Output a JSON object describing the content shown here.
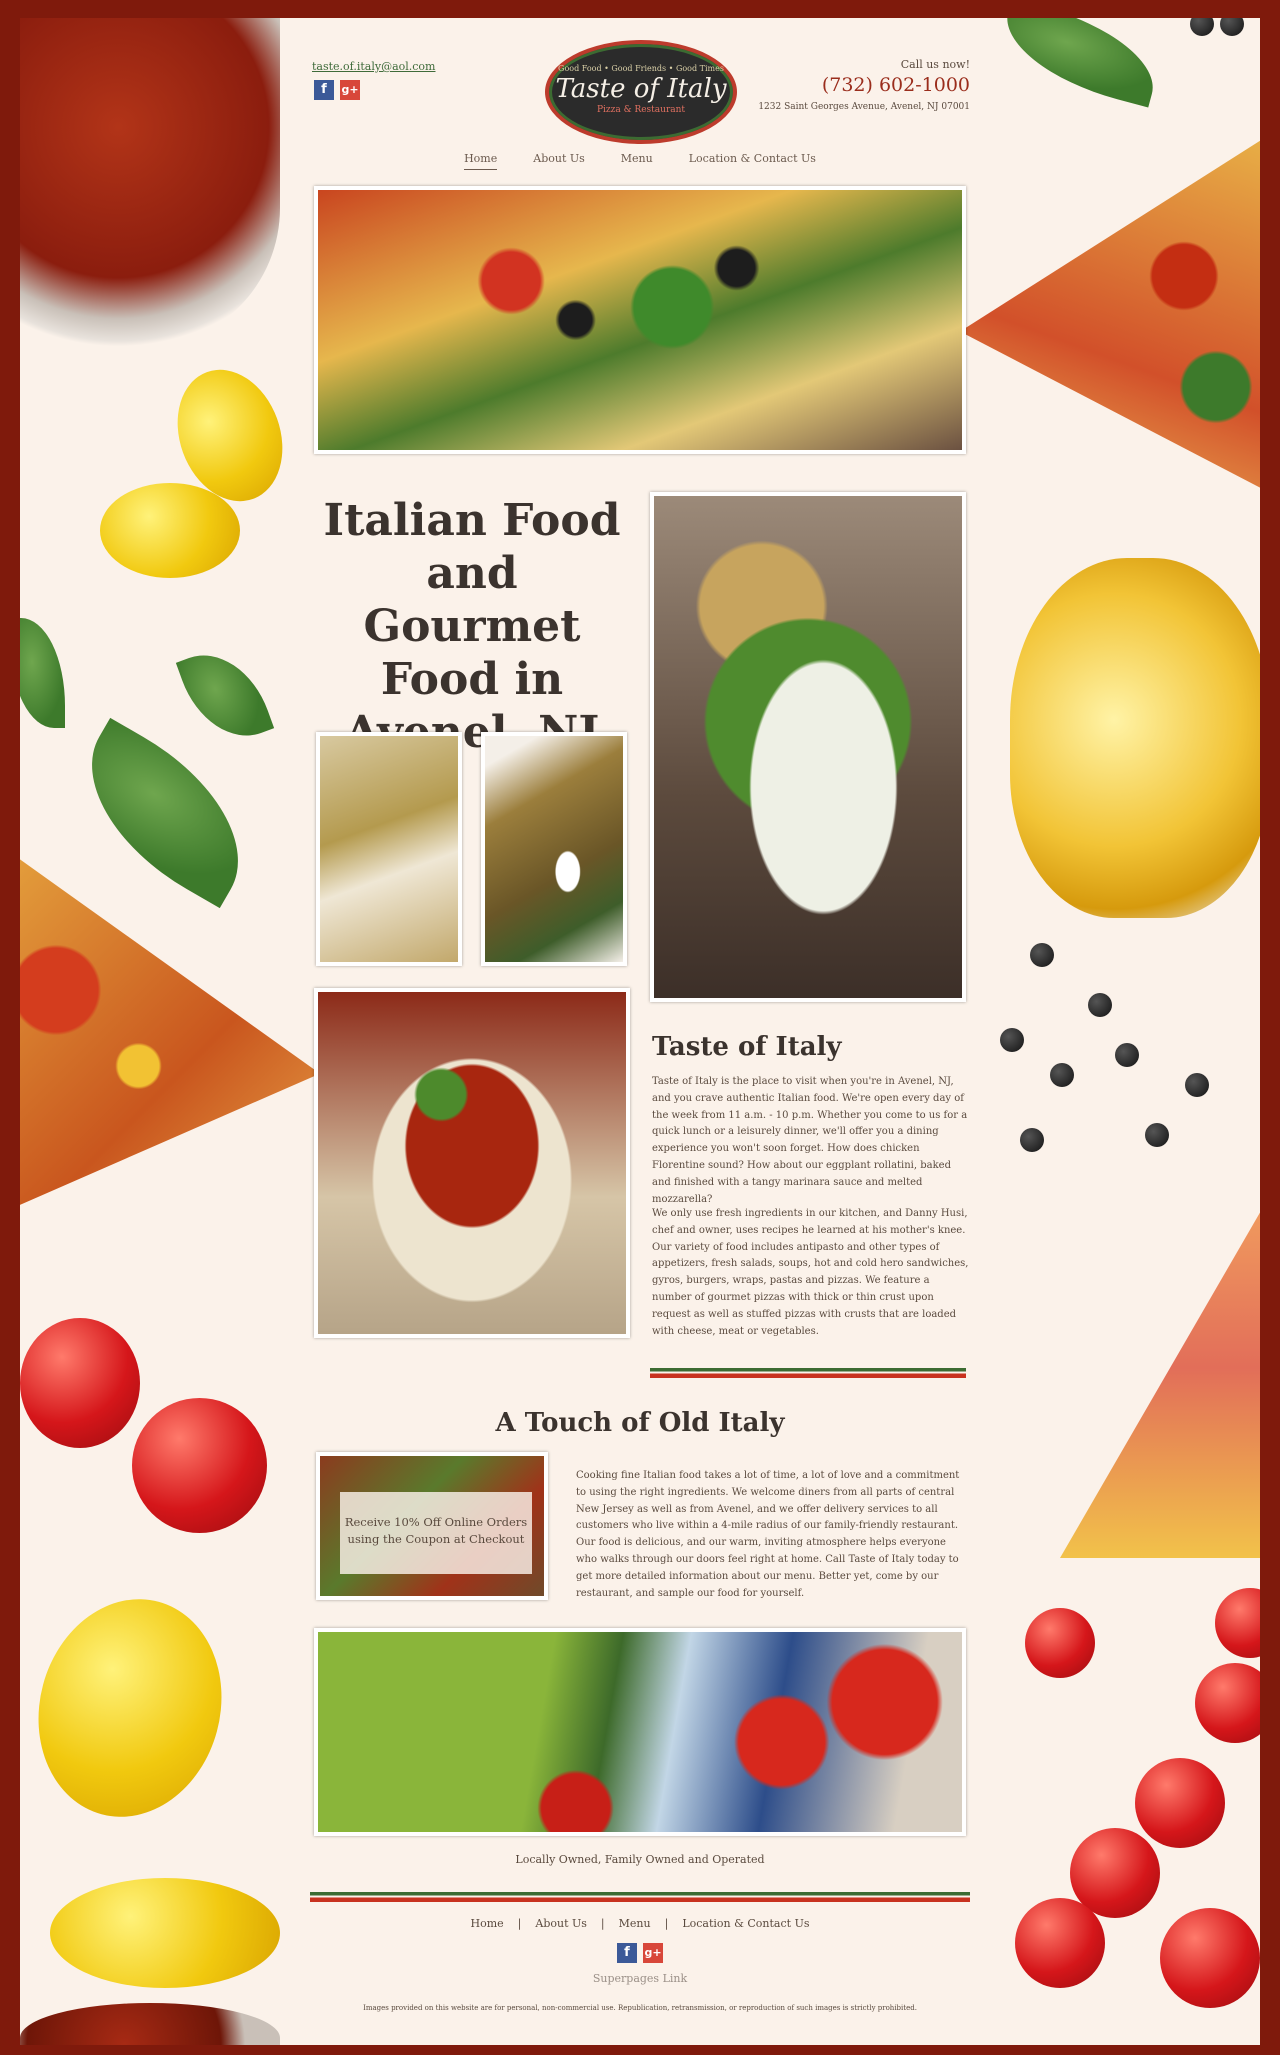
{
  "header": {
    "email": "taste.of.italy@aol.com",
    "logo": {
      "tagline": "Good Food • Good Friends • Good Times",
      "name": "Taste of Italy",
      "subtitle": "Pizza & Restaurant"
    },
    "call_label": "Call us now!",
    "phone": "(732) 602-1000",
    "address": "1232 Saint Georges Avenue, Avenel, NJ 07001",
    "social": {
      "facebook": "f",
      "google": "g+"
    }
  },
  "nav": {
    "items": [
      "Home",
      "About Us",
      "Menu",
      "Location & Contact Us"
    ],
    "active": "Home"
  },
  "main": {
    "headline": "Italian Food and Gourmet Food in Avenel, NJ",
    "about_title": "Taste of Italy",
    "about_p1": "Taste of Italy is the place to visit when you're in Avenel, NJ, and you crave authentic Italian food. We're open every day of the week from 11 a.m. - 10 p.m. Whether you come to us for a quick lunch or a leisurely dinner, we'll offer you a dining experience you won't soon forget. How does chicken Florentine sound? How about our eggplant rollatini, baked and finished with a tangy marinara sauce and melted mozzarella?",
    "about_p2": "We only use fresh ingredients in our kitchen, and Danny Husi, chef and owner, uses recipes he learned at his mother's knee. Our variety of food includes antipasto and other types of appetizers, fresh salads, soups, hot and cold hero sandwiches, gyros, burgers, wraps, pastas and pizzas. We feature a number of gourmet pizzas with thick or thin crust upon request as well as stuffed pizzas with crusts that are loaded with cheese, meat or vegetables.",
    "touch_title": "A Touch of Old Italy",
    "coupon_text": "Receive 10% Off Online Orders using the Coupon at Checkout",
    "touch_p": "Cooking fine Italian food takes a lot of time, a lot of love and a commitment to using the right ingredients. We welcome diners from all parts of central New Jersey as well as from Avenel, and we offer delivery services to all customers who live within a 4-mile radius of our family-friendly restaurant. Our food is delicious, and our warm, inviting atmosphere helps everyone who walks through our doors feel right at home. Call Taste of Italy today to get more detailed information about our menu. Better yet, come by our restaurant, and sample our food for yourself.",
    "tagline": "Locally Owned, Family Owned and Operated"
  },
  "footer": {
    "nav": [
      "Home",
      "About Us",
      "Menu",
      "Location & Contact Us"
    ],
    "separator": "|",
    "superpages": "Superpages Link",
    "disclaimer": "Images provided on this website are for personal, non-commercial use. Republication, retransmission, or reproduction of such images is strictly prohibited."
  },
  "colors": {
    "border": "#7f1a0c",
    "background": "#fbf2ea",
    "phone": "#9a2d1c",
    "flag_green": "#3c6b32",
    "flag_red": "#c8321f"
  }
}
